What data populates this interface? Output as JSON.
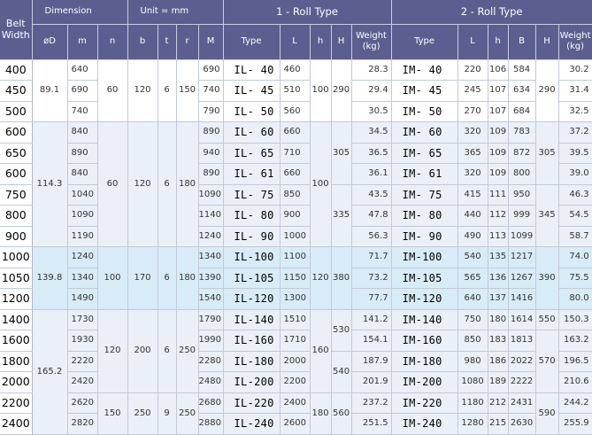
{
  "header": {
    "belt_width": "Belt\nWidth",
    "dimension": "Dimension",
    "unit": "Unit = mm",
    "roll1": "1 - Roll Type",
    "roll2": "2 - Roll Type",
    "phiD": "øD",
    "m": "m",
    "n": "n",
    "b": "b",
    "t": "t",
    "r": "r",
    "M": "M",
    "type1": "Type",
    "L1": "L",
    "h1": "h",
    "H1": "H",
    "weight1": "Weight\n(kg)",
    "type2": "Type",
    "L2": "L",
    "h2": "h",
    "B2": "B",
    "H2": "H",
    "weight2": "Weight\n(kg)"
  },
  "groups": [
    {
      "phiD": "89.1",
      "n": "60",
      "b": "120",
      "t": "6",
      "r": "150",
      "h1": "100",
      "H1": "290",
      "H2": "290"
    },
    {
      "phiD": "114.3",
      "n": "60",
      "b": "120",
      "t": "6",
      "r": "180",
      "h1": "100",
      "H1a": "305",
      "H1b": "335",
      "H2a": "305",
      "H2b": "345"
    },
    {
      "phiD": "139.8",
      "n": "100",
      "b": "170",
      "t": "6",
      "r": "180",
      "h1": "120",
      "H1": "380",
      "H2": "390"
    },
    {
      "phiD": "165.2",
      "n": "120",
      "b": "200",
      "t": "6",
      "r": "250",
      "h1": "160",
      "H1a": "530",
      "H1b": "540",
      "H2a": "550",
      "H2b": "570"
    },
    {
      "n": "150",
      "b": "250",
      "t": "9",
      "r": "250",
      "h1": "180",
      "H1": "560",
      "H2": "590"
    }
  ],
  "rows": [
    {
      "bw": "400",
      "m": "640",
      "M": "690",
      "type1": "IL- 40",
      "L1": "460",
      "w1": "28.3",
      "type2": "IM- 40",
      "L2": "220",
      "h2": "106",
      "B2": "584",
      "w2": "30.2"
    },
    {
      "bw": "450",
      "m": "690",
      "M": "740",
      "type1": "IL- 45",
      "L1": "510",
      "w1": "29.4",
      "type2": "IM- 45",
      "L2": "245",
      "h2": "107",
      "B2": "634",
      "w2": "31.4"
    },
    {
      "bw": "500",
      "m": "740",
      "M": "790",
      "type1": "IL- 50",
      "L1": "560",
      "w1": "30.5",
      "type2": "IM- 50",
      "L2": "270",
      "h2": "107",
      "B2": "684",
      "w2": "32.5"
    },
    {
      "bw": "600",
      "m": "840",
      "M": "890",
      "type1": "IL- 60",
      "L1": "660",
      "w1": "34.5",
      "type2": "IM- 60",
      "L2": "320",
      "h2": "109",
      "B2": "783",
      "w2": "37.2"
    },
    {
      "bw": "650",
      "m": "890",
      "M": "940",
      "type1": "IL- 65",
      "L1": "710",
      "w1": "36.5",
      "type2": "IM- 65",
      "L2": "365",
      "h2": "109",
      "B2": "872",
      "w2": "39.5"
    },
    {
      "bw": "600",
      "m": "840",
      "M": "890",
      "type1": "IL- 61",
      "L1": "660",
      "w1": "36.1",
      "type2": "IM- 61",
      "L2": "320",
      "h2": "109",
      "B2": "800",
      "w2": "39.0"
    },
    {
      "bw": "750",
      "m": "1040",
      "M": "1090",
      "type1": "IL- 75",
      "L1": "850",
      "w1": "43.5",
      "type2": "IM- 75",
      "L2": "415",
      "h2": "111",
      "B2": "950",
      "w2": "46.3"
    },
    {
      "bw": "800",
      "m": "1090",
      "M": "1140",
      "type1": "IL- 80",
      "L1": "900",
      "w1": "47.8",
      "type2": "IM- 80",
      "L2": "440",
      "h2": "112",
      "B2": "999",
      "w2": "54.5"
    },
    {
      "bw": "900",
      "m": "1190",
      "M": "1240",
      "type1": "IL- 90",
      "L1": "1000",
      "w1": "56.3",
      "type2": "IM- 90",
      "L2": "490",
      "h2": "113",
      "B2": "1099",
      "w2": "58.7"
    },
    {
      "bw": "1000",
      "m": "1240",
      "M": "1340",
      "type1": "IL-100",
      "L1": "1100",
      "w1": "71.7",
      "type2": "IM-100",
      "L2": "540",
      "h2": "135",
      "B2": "1217",
      "w2": "74.0"
    },
    {
      "bw": "1050",
      "m": "1340",
      "M": "1390",
      "type1": "IL-105",
      "L1": "1150",
      "w1": "73.2",
      "type2": "IM-105",
      "L2": "565",
      "h2": "136",
      "B2": "1267",
      "w2": "75.5"
    },
    {
      "bw": "1200",
      "m": "1490",
      "M": "1540",
      "type1": "IL-120",
      "L1": "1300",
      "w1": "77.7",
      "type2": "IM-120",
      "L2": "640",
      "h2": "137",
      "B2": "1416",
      "w2": "80.0"
    },
    {
      "bw": "1400",
      "m": "1730",
      "M": "1790",
      "type1": "IL-140",
      "L1": "1510",
      "w1": "141.2",
      "type2": "IM-140",
      "L2": "750",
      "h2": "180",
      "B2": "1614",
      "w2": "150.3"
    },
    {
      "bw": "1600",
      "m": "1930",
      "M": "1990",
      "type1": "IL-160",
      "L1": "1710",
      "w1": "154.1",
      "type2": "IM-160",
      "L2": "850",
      "h2": "183",
      "B2": "1813",
      "w2": "163.2"
    },
    {
      "bw": "1800",
      "m": "2220",
      "M": "2280",
      "type1": "IL-180",
      "L1": "2000",
      "w1": "187.9",
      "type2": "IM-180",
      "L2": "980",
      "h2": "186",
      "B2": "2022",
      "w2": "196.5"
    },
    {
      "bw": "2000",
      "m": "2420",
      "M": "2480",
      "type1": "IL-200",
      "L1": "2200",
      "w1": "201.9",
      "type2": "IM-200",
      "L2": "1080",
      "h2": "189",
      "B2": "2222",
      "w2": "210.6"
    },
    {
      "bw": "2200",
      "m": "2620",
      "M": "2680",
      "type1": "IL-220",
      "L1": "2400",
      "w1": "237.2",
      "type2": "IM-220",
      "L2": "1180",
      "h2": "212",
      "B2": "2431",
      "w2": "244.2"
    },
    {
      "bw": "2400",
      "m": "2820",
      "M": "2880",
      "type1": "IL-240",
      "L1": "2600",
      "w1": "251.5",
      "type2": "IM-240",
      "L2": "1280",
      "h2": "215",
      "B2": "2630",
      "w2": "255.9"
    }
  ]
}
